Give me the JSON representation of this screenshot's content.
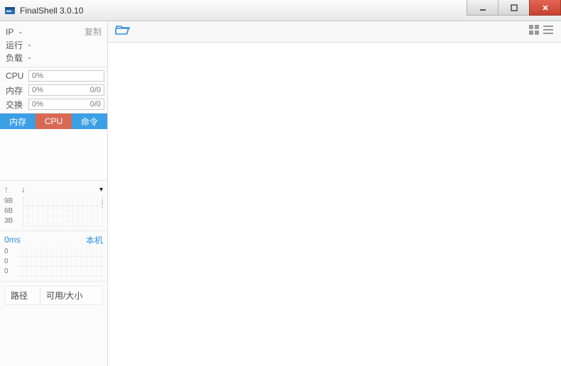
{
  "window": {
    "title": "FinalShell 3.0.10"
  },
  "sidebar": {
    "copy": "复制",
    "info": {
      "ip_label": "IP",
      "ip_value": "-",
      "run_label": "运行",
      "run_value": "-",
      "load_label": "负载",
      "load_value": "-"
    },
    "stats": {
      "cpu": {
        "label": "CPU",
        "pct": "0%",
        "ratio": ""
      },
      "mem": {
        "label": "内存",
        "pct": "0%",
        "ratio": "0/0"
      },
      "swap": {
        "label": "交换",
        "pct": "0%",
        "ratio": "0/0"
      }
    },
    "tabs": {
      "mem": "内存",
      "cpu": "CPU",
      "cmd": "命令"
    },
    "net": {
      "y": [
        "9B",
        "6B",
        "3B"
      ]
    },
    "latency": {
      "left": "0ms",
      "right": "本机",
      "y": [
        "0",
        "0",
        "0"
      ]
    },
    "path_table": {
      "col1": "路径",
      "col2": "可用/大小"
    }
  }
}
